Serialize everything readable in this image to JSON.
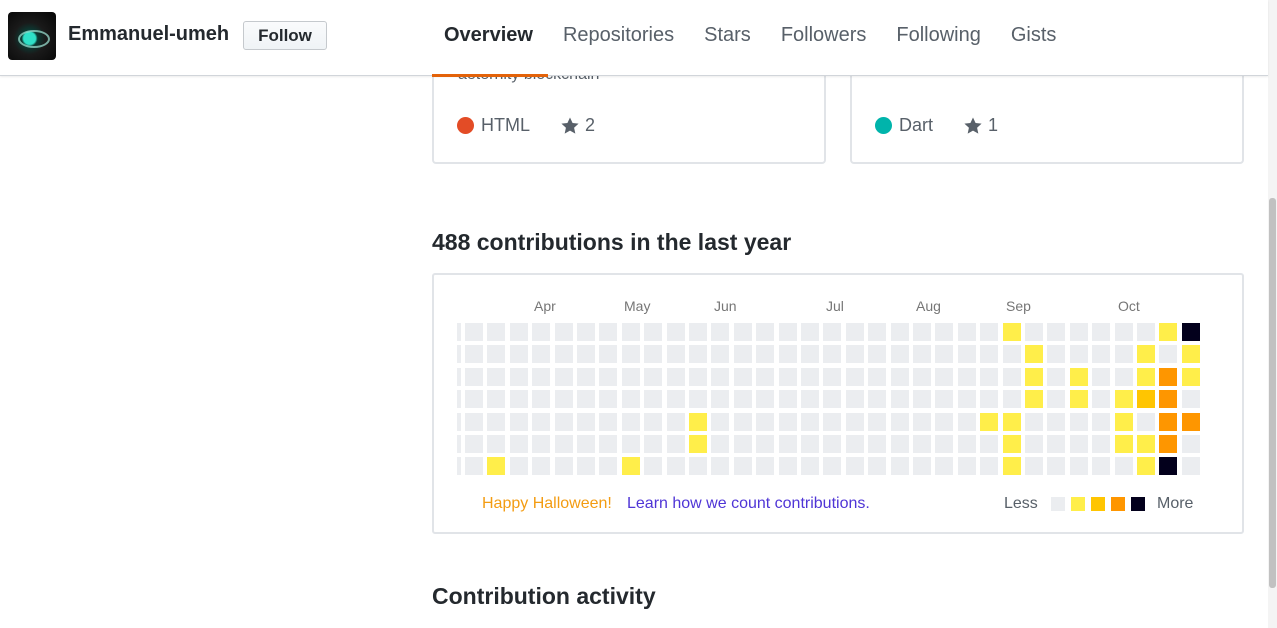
{
  "profile": {
    "username": "Emmanuel-umeh",
    "follow_label": "Follow"
  },
  "nav": {
    "tabs": [
      {
        "label": "Overview",
        "active": true
      },
      {
        "label": "Repositories",
        "active": false
      },
      {
        "label": "Stars",
        "active": false
      },
      {
        "label": "Followers",
        "active": false
      },
      {
        "label": "Following",
        "active": false
      },
      {
        "label": "Gists",
        "active": false
      }
    ],
    "active_color": "#e36209"
  },
  "pinned": [
    {
      "description": "aeternity blockchain",
      "language": "HTML",
      "language_color": "#e34c26",
      "stars": "2"
    },
    {
      "description": "",
      "language": "Dart",
      "language_color": "#00B4AB",
      "stars": "1"
    }
  ],
  "contributions": {
    "title": "488 contributions in the last year",
    "months": [
      "Apr",
      "May",
      "Jun",
      "Jul",
      "Aug",
      "Sep",
      "Oct"
    ],
    "colors": {
      "empty": "#ebedf0",
      "level1": "#ffee4a",
      "level2": "#ffc501",
      "level3": "#fe9600",
      "level4": "#03001c"
    },
    "legend": {
      "note": "Happy Halloween!",
      "link": "Learn how we count contributions.",
      "less": "Less",
      "more": "More"
    }
  },
  "activity": {
    "title": "Contribution activity"
  }
}
